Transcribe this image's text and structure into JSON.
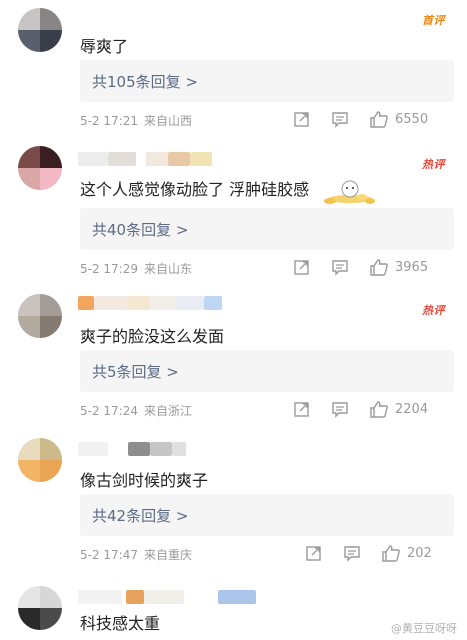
{
  "badges": {
    "first": "首评",
    "hot": "热评"
  },
  "comments": [
    {
      "text": "辱爽了",
      "reply": "共105条回复 >",
      "date": "5-2 17:21",
      "source": "来自山西",
      "likes": "6550",
      "badge": "首评"
    },
    {
      "text": "这个人感觉像动脸了 浮肿硅胶感",
      "reply": "共40条回复 >",
      "date": "5-2 17:29",
      "source": "来自山东",
      "likes": "3965",
      "badge": "热评"
    },
    {
      "text": "爽子的脸没这么发面",
      "reply": "共5条回复 >",
      "date": "5-2 17:24",
      "source": "来自浙江",
      "likes": "2204",
      "badge": "热评"
    },
    {
      "text": "像古剑时候的爽子",
      "reply": "共42条回复 >",
      "date": "5-2 17:47",
      "source": "来自重庆",
      "likes": "202",
      "badge": ""
    },
    {
      "text": "科技感太重",
      "reply": "",
      "date": "",
      "source": "",
      "likes": "",
      "badge": ""
    }
  ],
  "icons": [
    "share-icon",
    "comment-icon",
    "like-icon"
  ],
  "colors": {
    "reply_link": "#5b6b86",
    "first_badge": "#e8891a",
    "hot_badge": "#e8483a",
    "meta_gray": "#9a9a9a"
  },
  "watermark": "@黄豆豆呀呀"
}
